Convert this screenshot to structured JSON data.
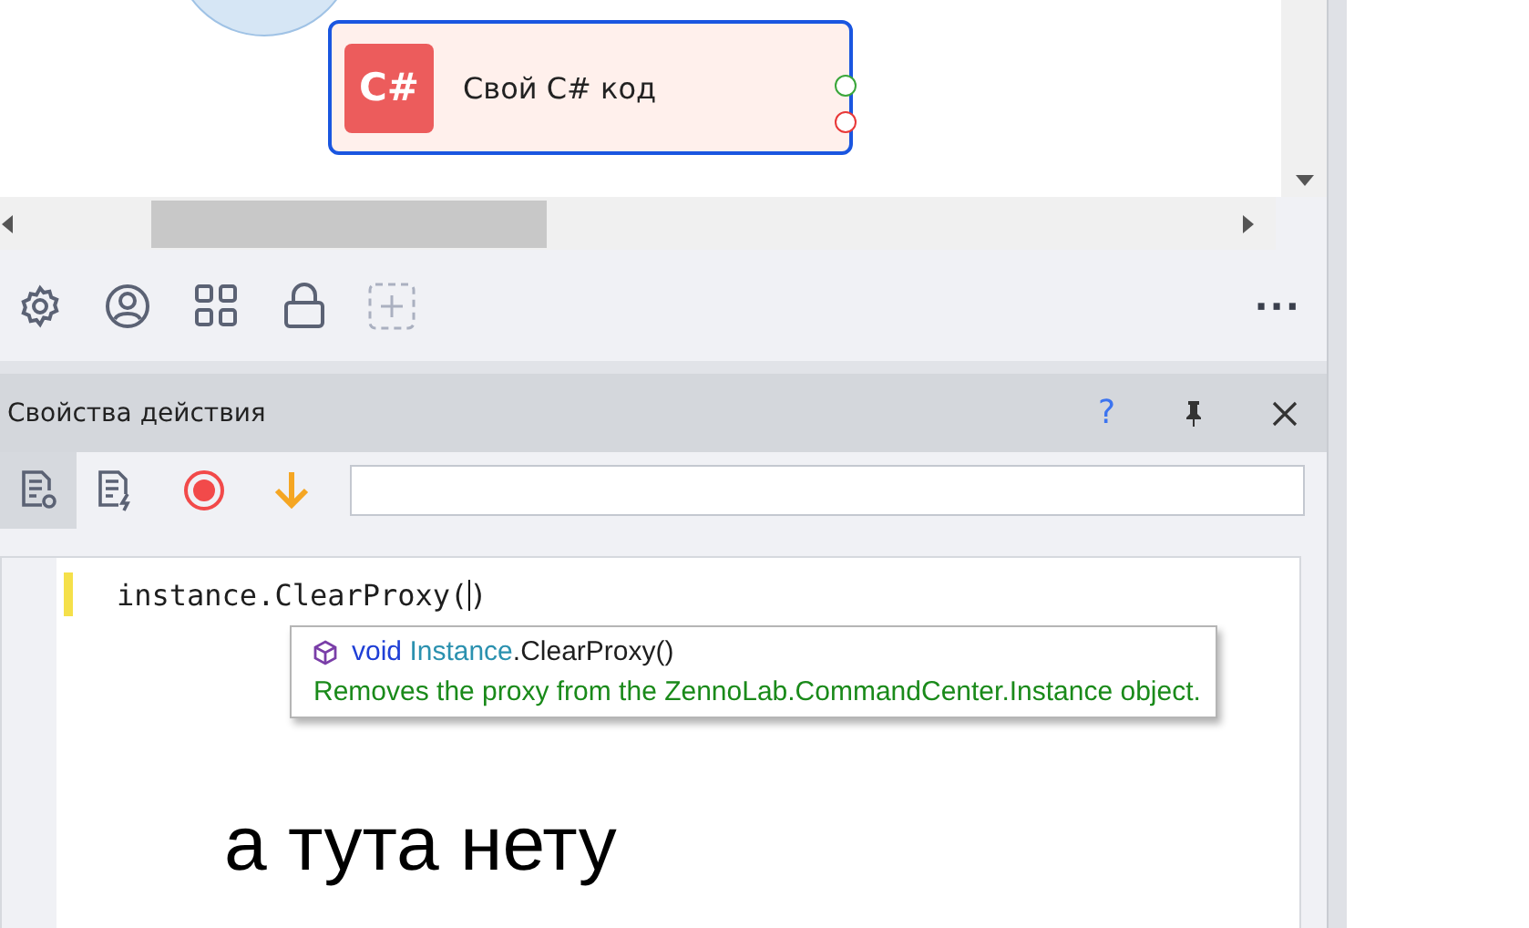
{
  "canvas": {
    "nodes": [
      {
        "kind": "circle"
      },
      {
        "kind": "action",
        "badge": "C#",
        "label": "Свой C# код",
        "selected": true
      }
    ]
  },
  "toolbar": {
    "more": "···"
  },
  "panel": {
    "title": "Свойства действия",
    "help": "?",
    "tabs": [
      {
        "selected": true
      },
      {
        "selected": false
      }
    ]
  },
  "editor": {
    "code_before_cursor": "instance.ClearProxy(",
    "code_after_cursor": ")",
    "tooltip": {
      "signature": [
        {
          "kind": "keyword",
          "text": "void"
        },
        {
          "kind": "type",
          "text": "Instance"
        },
        {
          "kind": "plain",
          "text": ".ClearProxy()"
        }
      ],
      "description": "Removes the proxy from the ZennoLab.CommandCenter.Instance object."
    },
    "annotation": "а тута нету"
  }
}
